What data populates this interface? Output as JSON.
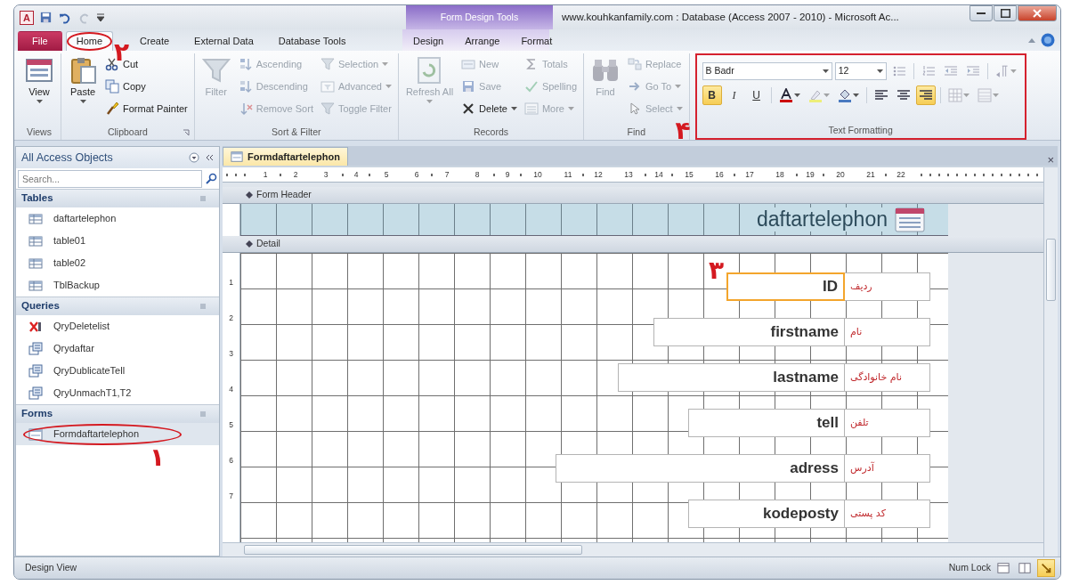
{
  "window": {
    "app_letter": "A",
    "contextual_label": "Form Design Tools",
    "title": "www.kouhkanfamily.com : Database (Access 2007 - 2010) - Microsoft Ac..."
  },
  "ribbon_tabs": [
    {
      "label": "File",
      "kind": "file",
      "selected": false,
      "circled": false
    },
    {
      "label": "Home",
      "kind": "tab",
      "selected": true,
      "circled": true,
      "annotation": "۲"
    },
    {
      "label": "Create",
      "kind": "tab",
      "selected": false,
      "circled": false
    },
    {
      "label": "External Data",
      "kind": "tab",
      "selected": false,
      "circled": false
    },
    {
      "label": "Database Tools",
      "kind": "tab",
      "selected": false,
      "circled": false
    },
    {
      "label": "Design",
      "kind": "contextual",
      "selected": false,
      "circled": false
    },
    {
      "label": "Arrange",
      "kind": "contextual",
      "selected": false,
      "circled": false
    },
    {
      "label": "Format",
      "kind": "contextual",
      "selected": false,
      "circled": false
    }
  ],
  "ribbon": {
    "groups": [
      {
        "label": "Views",
        "launcher": false,
        "columns": [
          [
            {
              "label": "View",
              "kind": "view",
              "large": true,
              "dropdown": true,
              "disabled": false
            }
          ]
        ]
      },
      {
        "label": "Clipboard",
        "launcher": true,
        "columns": [
          [
            {
              "label": "Paste",
              "kind": "paste",
              "large": true,
              "dropdown": true,
              "disabled": false
            }
          ],
          [
            {
              "label": "Cut",
              "kind": "cut",
              "large": false,
              "dropdown": false,
              "disabled": false
            },
            {
              "label": "Copy",
              "kind": "copy",
              "large": false,
              "dropdown": false,
              "disabled": false
            },
            {
              "label": "Format Painter",
              "kind": "painter",
              "large": false,
              "dropdown": false,
              "disabled": false
            }
          ]
        ]
      },
      {
        "label": "Sort & Filter",
        "launcher": false,
        "columns": [
          [
            {
              "label": "Filter",
              "kind": "filter",
              "large": true,
              "dropdown": false,
              "disabled": true
            }
          ],
          [
            {
              "label": "Ascending",
              "kind": "asc",
              "large": false,
              "dropdown": false,
              "disabled": true
            },
            {
              "label": "Descending",
              "kind": "desc",
              "large": false,
              "dropdown": false,
              "disabled": true
            },
            {
              "label": "Remove Sort",
              "kind": "removesort",
              "large": false,
              "dropdown": false,
              "disabled": true
            }
          ],
          [
            {
              "label": "Selection",
              "kind": "selection",
              "large": false,
              "dropdown": true,
              "disabled": true
            },
            {
              "label": "Advanced",
              "kind": "advanced",
              "large": false,
              "dropdown": true,
              "disabled": true
            },
            {
              "label": "Toggle Filter",
              "kind": "togglefilter",
              "large": false,
              "dropdown": false,
              "disabled": true
            }
          ]
        ]
      },
      {
        "label": "Records",
        "launcher": false,
        "columns": [
          [
            {
              "label": "Refresh All",
              "kind": "refresh",
              "large": true,
              "dropdown": true,
              "disabled": true
            }
          ],
          [
            {
              "label": "New",
              "kind": "new",
              "large": false,
              "dropdown": false,
              "disabled": true
            },
            {
              "label": "Save",
              "kind": "save",
              "large": false,
              "dropdown": false,
              "disabled": true
            },
            {
              "label": "Delete",
              "kind": "delete",
              "large": false,
              "dropdown": true,
              "disabled": false
            }
          ],
          [
            {
              "label": "Totals",
              "kind": "totals",
              "large": false,
              "dropdown": false,
              "disabled": true
            },
            {
              "label": "Spelling",
              "kind": "spelling",
              "large": false,
              "dropdown": false,
              "disabled": true
            },
            {
              "label": "More",
              "kind": "more",
              "large": false,
              "dropdown": true,
              "disabled": true
            }
          ]
        ]
      },
      {
        "label": "Find",
        "launcher": false,
        "columns": [
          [
            {
              "label": "Find",
              "kind": "find",
              "large": true,
              "dropdown": false,
              "disabled": true
            }
          ],
          [
            {
              "label": "Replace",
              "kind": "replace",
              "large": false,
              "dropdown": false,
              "disabled": true
            },
            {
              "label": "Go To",
              "kind": "goto",
              "large": false,
              "dropdown": true,
              "disabled": true
            },
            {
              "label": "Select",
              "kind": "select",
              "large": false,
              "dropdown": true,
              "disabled": true
            }
          ]
        ]
      }
    ]
  },
  "text_formatting": {
    "label": "Text Formatting",
    "highlighted": true,
    "annotation": "۴",
    "rows": [
      [
        {
          "kind": "font-field",
          "value": "B Badr"
        },
        {
          "kind": "size-field",
          "value": "12"
        },
        {
          "kind": "bullets",
          "selected": false,
          "dropdown": false,
          "disabled": true
        },
        {
          "kind": "numbering",
          "selected": false,
          "dropdown": false,
          "disabled": true
        },
        {
          "kind": "outdent",
          "selected": false,
          "dropdown": false,
          "disabled": true
        },
        {
          "kind": "indent",
          "selected": false,
          "dropdown": false,
          "disabled": true
        },
        {
          "kind": "rtl",
          "selected": false,
          "dropdown": true,
          "disabled": true
        }
      ],
      [
        {
          "kind": "text",
          "label": "B",
          "selected": true,
          "dropdown": false,
          "disabled": false
        },
        {
          "kind": "text",
          "label": "I",
          "selected": false,
          "dropdown": false,
          "disabled": false
        },
        {
          "kind": "text",
          "label": "U",
          "selected": false,
          "dropdown": false,
          "disabled": false
        },
        {
          "kind": "fontcolor",
          "selected": false,
          "dropdown": true,
          "disabled": false
        },
        {
          "kind": "highlight",
          "selected": false,
          "dropdown": true,
          "disabled": true
        },
        {
          "kind": "fill",
          "selected": false,
          "dropdown": true,
          "disabled": false
        },
        {
          "kind": "alignleft",
          "selected": false,
          "dropdown": false,
          "disabled": false
        },
        {
          "kind": "aligncenter",
          "selected": false,
          "dropdown": false,
          "disabled": false
        },
        {
          "kind": "alignright",
          "selected": true,
          "dropdown": false,
          "disabled": false
        },
        {
          "kind": "gridlines",
          "selected": false,
          "dropdown": true,
          "disabled": true
        },
        {
          "kind": "borders",
          "selected": false,
          "dropdown": true,
          "disabled": true
        }
      ]
    ]
  },
  "nav": {
    "title": "All Access Objects",
    "search": {
      "placeholder": "Search..."
    },
    "groups": [
      {
        "label": "Tables",
        "items": [
          {
            "label": "daftartelephon",
            "kind": "table",
            "selected": false,
            "circled": false
          },
          {
            "label": "table01",
            "kind": "table",
            "selected": false,
            "circled": false
          },
          {
            "label": "table02",
            "kind": "table",
            "selected": false,
            "circled": false
          },
          {
            "label": "TblBackup",
            "kind": "table",
            "selected": false,
            "circled": false
          }
        ]
      },
      {
        "label": "Queries",
        "items": [
          {
            "label": "QryDeletelist",
            "kind": "delete-query",
            "selected": false,
            "circled": false
          },
          {
            "label": "Qrydaftar",
            "kind": "query",
            "selected": false,
            "circled": false
          },
          {
            "label": "QryDublicateTell",
            "kind": "query",
            "selected": false,
            "circled": false
          },
          {
            "label": "QryUnmachT1,T2",
            "kind": "query",
            "selected": false,
            "circled": false
          }
        ]
      },
      {
        "label": "Forms",
        "items": [
          {
            "label": "Formdaftartelephon",
            "kind": "form",
            "selected": true,
            "circled": true,
            "annotation": "۱"
          }
        ]
      }
    ]
  },
  "document": {
    "tabs": [
      {
        "label": "Formdaftartelephon",
        "selected": true
      }
    ],
    "close": "×",
    "ruler_h": [
      "1",
      "2",
      "3",
      "4",
      "5",
      "6",
      "7",
      "8",
      "9",
      "10",
      "11",
      "12",
      "13",
      "14",
      "15",
      "16",
      "17",
      "18",
      "19",
      "20",
      "21",
      "22"
    ],
    "ruler_v": [
      "1",
      "2",
      "3",
      "4",
      "5",
      "6",
      "7"
    ],
    "form_header": {
      "label": "Form Header",
      "title": "daftartelephon"
    },
    "detail": {
      "label": "Detail",
      "controls": [
        {
          "field": "ID",
          "label": "ردیف",
          "selected": true,
          "annotation": "۳"
        },
        {
          "field": "firstname",
          "label": "نام",
          "selected": false
        },
        {
          "field": "lastname",
          "label": "نام خانوادگی",
          "selected": false
        },
        {
          "field": "tell",
          "label": "تلفن",
          "selected": false
        },
        {
          "field": "adress",
          "label": "آدرس",
          "selected": false
        },
        {
          "field": "kodeposty",
          "label": "کد پستی",
          "selected": false
        }
      ]
    }
  },
  "status": {
    "text": "Design View",
    "indicator": "Num Lock",
    "views": [
      {
        "kind": "form",
        "selected": false
      },
      {
        "kind": "layout",
        "selected": false
      },
      {
        "kind": "design",
        "selected": true
      }
    ]
  }
}
